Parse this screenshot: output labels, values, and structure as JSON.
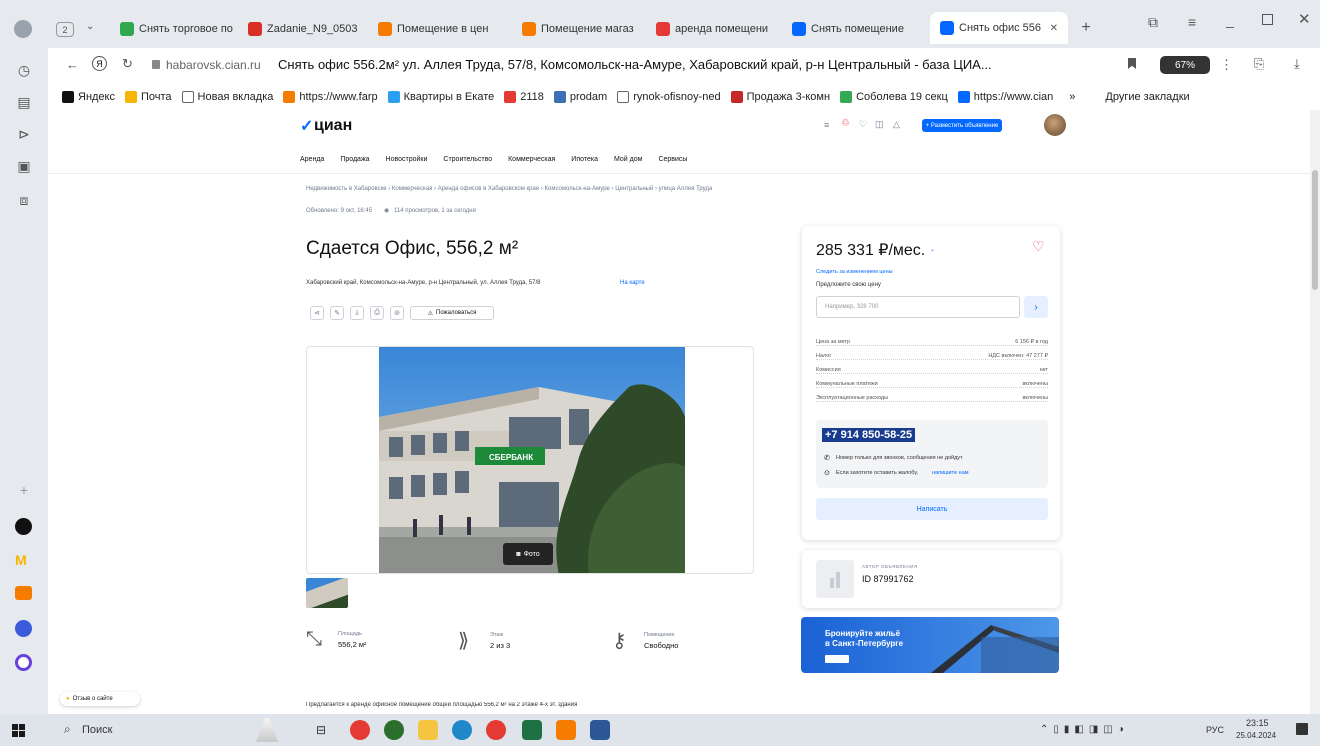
{
  "browser": {
    "tab_count": "2",
    "tabs": [
      {
        "title": "Снять торговое по",
        "color": "#2fa84f"
      },
      {
        "title": "Zadanie_N9_0503",
        "color": "#d93025"
      },
      {
        "title": "Помещение в цен",
        "color": "#f57c00"
      },
      {
        "title": "Помещение магаз",
        "color": "#f57c00"
      },
      {
        "title": "аренда помещени",
        "color": "#e53935"
      },
      {
        "title": "Снять помещение",
        "color": "#0468ff"
      },
      {
        "title": "Снять офис 556",
        "color": "#0468ff",
        "active": true
      }
    ],
    "domain": "habarovsk.cian.ru",
    "page_title": "Снять офис 556.2м² ул. Аллея Труда, 57/8, Комсомольск-на-Амуре, Хабаровский край, р-н Центральный - база ЦИА...",
    "protect_badge": "67%",
    "bookmarks": [
      {
        "label": "Яндекс",
        "color": "#111"
      },
      {
        "label": "Почта",
        "color": "#f7b500"
      },
      {
        "label": "Новая вкладка",
        "color": "#ffffff"
      },
      {
        "label": "https://www.farp",
        "color": "#f57c00"
      },
      {
        "label": "Квартиры в Екате",
        "color": "#2aa0f0"
      },
      {
        "label": "2118",
        "color": "#e53935"
      },
      {
        "label": "prodam",
        "color": "#3d6fb6"
      },
      {
        "label": "rynok-ofisnoy-ned",
        "color": "#ffffff"
      },
      {
        "label": "Продажа 3-комн",
        "color": "#c62828"
      },
      {
        "label": "Соболева 19 секц",
        "color": "#34a853"
      },
      {
        "label": "https://www.cian",
        "color": "#0468ff"
      }
    ],
    "other_bookmarks": "Другие закладки"
  },
  "site": {
    "logo": "циан",
    "post_ad_button": "+ Разместить объявление",
    "nav": [
      "Аренда",
      "Продажа",
      "Новостройки",
      "Строительство",
      "Коммерческая",
      "Ипотека",
      "Мой дом",
      "Сервисы"
    ],
    "breadcrumbs": "Недвижимость в Хабаровске › Коммерческая › Аренда офисов в Хабаровском крае › Комсомольск-на-Амуре › Центральный › улица Аллея Труда",
    "updated": "Обновлено: 9 окт, 16:45",
    "views": "114 просмотров, 1 за сегодня",
    "heading": "Сдается Офис, 556,2 м²",
    "address": "Хабаровский край, Комсомольск-на-Амуре, р-н Центральный, ул. Аллея Труда, 57/8",
    "map_link": "На карте",
    "complain": "Пожаловаться",
    "photo_button": "Фото",
    "sign": "СБЕРБАНК",
    "features": [
      {
        "label": "Площадь",
        "value": "556,2 м²",
        "icon": "area-icon"
      },
      {
        "label": "Этаж",
        "value": "2 из 3",
        "icon": "stairs-icon"
      },
      {
        "label": "Помещение",
        "value": "Свободно",
        "icon": "key-icon"
      }
    ],
    "feedback": "Отзыв о сайте",
    "description_cut": "Предлагается к аренде офисное помещение общей площадью 556,2 м² на 2 этаже 4-х эт. здания"
  },
  "price_card": {
    "price": "285 331 ₽/мес.",
    "watch_link": "Следить за изменением цены",
    "offer_label": "Предложите свою цену",
    "offer_placeholder": "Например, 326 700",
    "details": [
      {
        "k": "Цена за метр",
        "v": "6 156 ₽ в год"
      },
      {
        "k": "Налог",
        "v": "НДС включен: 47 277 ₽"
      },
      {
        "k": "Комиссия",
        "v": "нет"
      },
      {
        "k": "Коммунальные платежи",
        "v": "включены"
      },
      {
        "k": "Эксплуатационные расходы",
        "v": "включены"
      }
    ],
    "phone": "+7 914 850-58-25",
    "phone_note": "Номер только для звонков, сообщения не дойдут",
    "complaint_note": "Если захотите оставить жалобу,",
    "complaint_link": "напишите нам",
    "write_button": "Написать"
  },
  "author": {
    "label": "АВТОР ОБЪЯВЛЕНИЯ",
    "id": "ID 87991762"
  },
  "promo": {
    "line1": "Бронируйте жильё",
    "line2": "в Санкт-Петербурге"
  },
  "taskbar": {
    "search": "Поиск",
    "lang": "РУС",
    "time": "23:15",
    "date": "25.04.2024"
  }
}
